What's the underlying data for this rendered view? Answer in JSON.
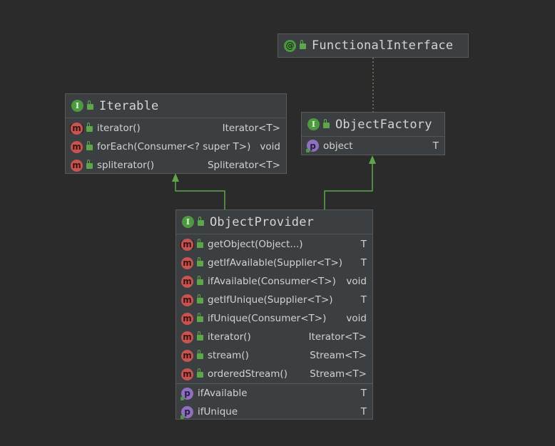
{
  "nodes": {
    "functional_interface": {
      "badge": "@",
      "title": "FunctionalInterface"
    },
    "iterable": {
      "badge": "I",
      "title": "Iterable",
      "methods": [
        {
          "badge": "m",
          "name": "iterator()",
          "type": "Iterator<T>"
        },
        {
          "badge": "m",
          "name": "forEach(Consumer<? super T>)",
          "type": "void"
        },
        {
          "badge": "m",
          "name": "spliterator()",
          "type": "Spliterator<T>"
        }
      ]
    },
    "object_factory": {
      "badge": "I",
      "title": "ObjectFactory",
      "properties": [
        {
          "badge": "p",
          "name": "object",
          "type": "T"
        }
      ]
    },
    "object_provider": {
      "badge": "I",
      "title": "ObjectProvider",
      "methods": [
        {
          "badge": "m",
          "name": "getObject(Object...)",
          "type": "T"
        },
        {
          "badge": "m",
          "name": "getIfAvailable(Supplier<T>)",
          "type": "T"
        },
        {
          "badge": "m",
          "name": "ifAvailable(Consumer<T>)",
          "type": "void"
        },
        {
          "badge": "m",
          "name": "getIfUnique(Supplier<T>)",
          "type": "T"
        },
        {
          "badge": "m",
          "name": "ifUnique(Consumer<T>)",
          "type": "void"
        },
        {
          "badge": "m",
          "name": "iterator()",
          "type": "Iterator<T>"
        },
        {
          "badge": "m",
          "name": "stream()",
          "type": "Stream<T>"
        },
        {
          "badge": "m",
          "name": "orderedStream()",
          "type": "Stream<T>"
        }
      ],
      "properties": [
        {
          "badge": "p",
          "name": "ifAvailable",
          "type": "T"
        },
        {
          "badge": "p",
          "name": "ifUnique",
          "type": "T"
        }
      ]
    }
  },
  "colors": {
    "background": "#2b2b2b",
    "node_fill": "#3c3f41",
    "inheritance_edge": "#5ea64a",
    "annotation_edge": "#6a8759"
  }
}
